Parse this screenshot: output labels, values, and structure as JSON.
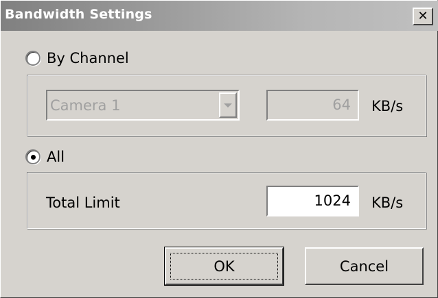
{
  "window": {
    "title": "Bandwidth Settings",
    "close_glyph": "✕"
  },
  "by_channel": {
    "label": "By Channel",
    "selected": false,
    "channel_select": {
      "value": "Camera 1",
      "enabled": false
    },
    "rate_value": "64",
    "unit": "KB/s"
  },
  "all": {
    "label": "All",
    "selected": true,
    "total_limit_label": "Total Limit",
    "total_limit_value": "1024",
    "unit": "KB/s"
  },
  "buttons": {
    "ok": "OK",
    "cancel": "Cancel"
  },
  "colors": {
    "dialog_bg": "#d6d3ce",
    "titlebar_start": "#808080",
    "disabled_text": "#a0a0a0"
  }
}
